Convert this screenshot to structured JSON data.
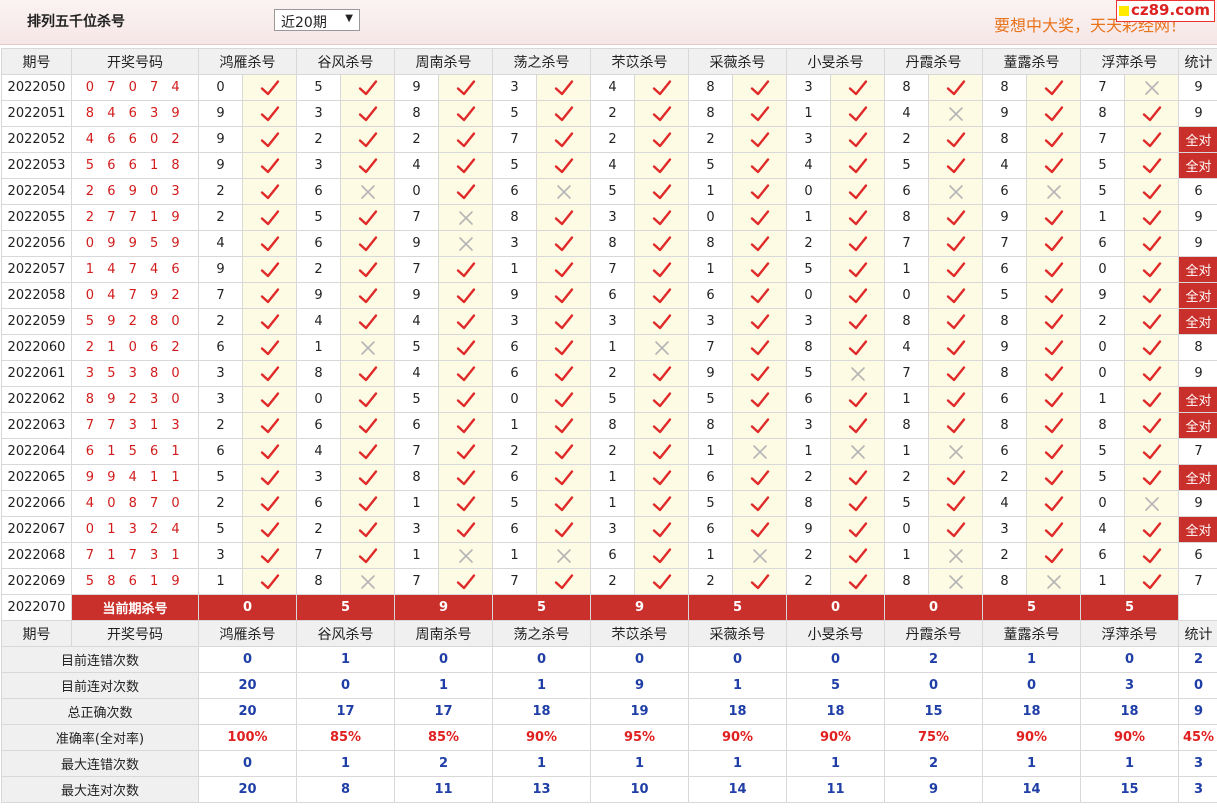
{
  "header": {
    "title": "排列五千位杀号",
    "range_selected": "近20期",
    "ad_text": "要想中大奖，天天彩经网！",
    "logo_text": "cz89.com"
  },
  "columns": {
    "period": "期号",
    "draw": "开奖号码",
    "experts": [
      "鸿雁杀号",
      "谷风杀号",
      "周南杀号",
      "荡之杀号",
      "芣苡杀号",
      "采薇杀号",
      "小旻杀号",
      "丹霞杀号",
      "蕫露杀号",
      "浮萍杀号"
    ],
    "stat": "统计"
  },
  "rows": [
    {
      "period": "2022050",
      "draw": "0 7 0 7 4",
      "kills": [
        "0",
        "5",
        "9",
        "3",
        "4",
        "8",
        "3",
        "8",
        "8",
        "7"
      ],
      "results": [
        "ok",
        "ok",
        "ok",
        "ok",
        "ok",
        "ok",
        "ok",
        "ok",
        "ok",
        "no"
      ],
      "stat": "9"
    },
    {
      "period": "2022051",
      "draw": "8 4 6 3 9",
      "kills": [
        "9",
        "3",
        "8",
        "5",
        "2",
        "8",
        "1",
        "4",
        "9",
        "8"
      ],
      "results": [
        "ok",
        "ok",
        "ok",
        "ok",
        "ok",
        "ok",
        "ok",
        "no",
        "ok",
        "ok"
      ],
      "stat": "9"
    },
    {
      "period": "2022052",
      "draw": "4 6 6 0 2",
      "kills": [
        "9",
        "2",
        "2",
        "7",
        "2",
        "2",
        "3",
        "2",
        "8",
        "7"
      ],
      "results": [
        "ok",
        "ok",
        "ok",
        "ok",
        "ok",
        "ok",
        "ok",
        "ok",
        "ok",
        "ok"
      ],
      "stat": "全对"
    },
    {
      "period": "2022053",
      "draw": "5 6 6 1 8",
      "kills": [
        "9",
        "3",
        "4",
        "5",
        "4",
        "5",
        "4",
        "5",
        "4",
        "5"
      ],
      "results": [
        "ok",
        "ok",
        "ok",
        "ok",
        "ok",
        "ok",
        "ok",
        "ok",
        "ok",
        "ok"
      ],
      "stat": "全对"
    },
    {
      "period": "2022054",
      "draw": "2 6 9 0 3",
      "kills": [
        "2",
        "6",
        "0",
        "6",
        "5",
        "1",
        "0",
        "6",
        "6",
        "5"
      ],
      "results": [
        "ok",
        "no",
        "ok",
        "no",
        "ok",
        "ok",
        "ok",
        "no",
        "no",
        "ok"
      ],
      "stat": "6"
    },
    {
      "period": "2022055",
      "draw": "2 7 7 1 9",
      "kills": [
        "2",
        "5",
        "7",
        "8",
        "3",
        "0",
        "1",
        "8",
        "9",
        "1"
      ],
      "results": [
        "ok",
        "ok",
        "no",
        "ok",
        "ok",
        "ok",
        "ok",
        "ok",
        "ok",
        "ok"
      ],
      "stat": "9"
    },
    {
      "period": "2022056",
      "draw": "0 9 9 5 9",
      "kills": [
        "4",
        "6",
        "9",
        "3",
        "8",
        "8",
        "2",
        "7",
        "7",
        "6"
      ],
      "results": [
        "ok",
        "ok",
        "no",
        "ok",
        "ok",
        "ok",
        "ok",
        "ok",
        "ok",
        "ok"
      ],
      "stat": "9"
    },
    {
      "period": "2022057",
      "draw": "1 4 7 4 6",
      "kills": [
        "9",
        "2",
        "7",
        "1",
        "7",
        "1",
        "5",
        "1",
        "6",
        "0"
      ],
      "results": [
        "ok",
        "ok",
        "ok",
        "ok",
        "ok",
        "ok",
        "ok",
        "ok",
        "ok",
        "ok"
      ],
      "stat": "全对"
    },
    {
      "period": "2022058",
      "draw": "0 4 7 9 2",
      "kills": [
        "7",
        "9",
        "9",
        "9",
        "6",
        "6",
        "0",
        "0",
        "5",
        "9"
      ],
      "results": [
        "ok",
        "ok",
        "ok",
        "ok",
        "ok",
        "ok",
        "ok",
        "ok",
        "ok",
        "ok"
      ],
      "stat": "全对"
    },
    {
      "period": "2022059",
      "draw": "5 9 2 8 0",
      "kills": [
        "2",
        "4",
        "4",
        "3",
        "3",
        "3",
        "3",
        "8",
        "8",
        "2"
      ],
      "results": [
        "ok",
        "ok",
        "ok",
        "ok",
        "ok",
        "ok",
        "ok",
        "ok",
        "ok",
        "ok"
      ],
      "stat": "全对"
    },
    {
      "period": "2022060",
      "draw": "2 1 0 6 2",
      "kills": [
        "6",
        "1",
        "5",
        "6",
        "1",
        "7",
        "8",
        "4",
        "9",
        "0"
      ],
      "results": [
        "ok",
        "no",
        "ok",
        "ok",
        "no",
        "ok",
        "ok",
        "ok",
        "ok",
        "ok"
      ],
      "stat": "8"
    },
    {
      "period": "2022061",
      "draw": "3 5 3 8 0",
      "kills": [
        "3",
        "8",
        "4",
        "6",
        "2",
        "9",
        "5",
        "7",
        "8",
        "0"
      ],
      "results": [
        "ok",
        "ok",
        "ok",
        "ok",
        "ok",
        "ok",
        "no",
        "ok",
        "ok",
        "ok"
      ],
      "stat": "9"
    },
    {
      "period": "2022062",
      "draw": "8 9 2 3 0",
      "kills": [
        "3",
        "0",
        "5",
        "0",
        "5",
        "5",
        "6",
        "1",
        "6",
        "1"
      ],
      "results": [
        "ok",
        "ok",
        "ok",
        "ok",
        "ok",
        "ok",
        "ok",
        "ok",
        "ok",
        "ok"
      ],
      "stat": "全对"
    },
    {
      "period": "2022063",
      "draw": "7 7 3 1 3",
      "kills": [
        "2",
        "6",
        "6",
        "1",
        "8",
        "8",
        "3",
        "8",
        "8",
        "8"
      ],
      "results": [
        "ok",
        "ok",
        "ok",
        "ok",
        "ok",
        "ok",
        "ok",
        "ok",
        "ok",
        "ok"
      ],
      "stat": "全对"
    },
    {
      "period": "2022064",
      "draw": "6 1 5 6 1",
      "kills": [
        "6",
        "4",
        "7",
        "2",
        "2",
        "1",
        "1",
        "1",
        "6",
        "5"
      ],
      "results": [
        "ok",
        "ok",
        "ok",
        "ok",
        "ok",
        "no",
        "no",
        "no",
        "ok",
        "ok"
      ],
      "stat": "7"
    },
    {
      "period": "2022065",
      "draw": "9 9 4 1 1",
      "kills": [
        "5",
        "3",
        "8",
        "6",
        "1",
        "6",
        "2",
        "2",
        "2",
        "5"
      ],
      "results": [
        "ok",
        "ok",
        "ok",
        "ok",
        "ok",
        "ok",
        "ok",
        "ok",
        "ok",
        "ok"
      ],
      "stat": "全对"
    },
    {
      "period": "2022066",
      "draw": "4 0 8 7 0",
      "kills": [
        "2",
        "6",
        "1",
        "5",
        "1",
        "5",
        "8",
        "5",
        "4",
        "0"
      ],
      "results": [
        "ok",
        "ok",
        "ok",
        "ok",
        "ok",
        "ok",
        "ok",
        "ok",
        "ok",
        "no"
      ],
      "stat": "9"
    },
    {
      "period": "2022067",
      "draw": "0 1 3 2 4",
      "kills": [
        "5",
        "2",
        "3",
        "6",
        "3",
        "6",
        "9",
        "0",
        "3",
        "4"
      ],
      "results": [
        "ok",
        "ok",
        "ok",
        "ok",
        "ok",
        "ok",
        "ok",
        "ok",
        "ok",
        "ok"
      ],
      "stat": "全对"
    },
    {
      "period": "2022068",
      "draw": "7 1 7 3 1",
      "kills": [
        "3",
        "7",
        "1",
        "1",
        "6",
        "1",
        "2",
        "1",
        "2",
        "6"
      ],
      "results": [
        "ok",
        "ok",
        "no",
        "no",
        "ok",
        "no",
        "ok",
        "no",
        "ok",
        "ok"
      ],
      "stat": "6"
    },
    {
      "period": "2022069",
      "draw": "5 8 6 1 9",
      "kills": [
        "1",
        "8",
        "7",
        "7",
        "2",
        "2",
        "2",
        "8",
        "8",
        "1"
      ],
      "results": [
        "ok",
        "no",
        "ok",
        "ok",
        "ok",
        "ok",
        "ok",
        "no",
        "no",
        "ok"
      ],
      "stat": "7"
    }
  ],
  "current": {
    "period": "2022070",
    "label": "当前期杀号",
    "kills": [
      "0",
      "5",
      "9",
      "5",
      "9",
      "5",
      "0",
      "0",
      "5",
      "5"
    ]
  },
  "stats": [
    {
      "label": "目前连错次数",
      "values": [
        "0",
        "1",
        "0",
        "0",
        "0",
        "0",
        "0",
        "2",
        "1",
        "0"
      ],
      "stat": "2",
      "pct": false
    },
    {
      "label": "目前连对次数",
      "values": [
        "20",
        "0",
        "1",
        "1",
        "9",
        "1",
        "5",
        "0",
        "0",
        "3"
      ],
      "stat": "0",
      "pct": false
    },
    {
      "label": "总正确次数",
      "values": [
        "20",
        "17",
        "17",
        "18",
        "19",
        "18",
        "18",
        "15",
        "18",
        "18"
      ],
      "stat": "9",
      "pct": false
    },
    {
      "label": "准确率(全对率)",
      "values": [
        "100%",
        "85%",
        "85%",
        "90%",
        "95%",
        "90%",
        "90%",
        "75%",
        "90%",
        "90%"
      ],
      "stat": "45%",
      "pct": true
    },
    {
      "label": "最大连错次数",
      "values": [
        "0",
        "1",
        "2",
        "1",
        "1",
        "1",
        "1",
        "2",
        "1",
        "1"
      ],
      "stat": "3",
      "pct": false
    },
    {
      "label": "最大连对次数",
      "values": [
        "20",
        "8",
        "11",
        "13",
        "10",
        "14",
        "11",
        "9",
        "14",
        "15"
      ],
      "stat": "3",
      "pct": false
    }
  ],
  "colors": {
    "accent": "#c9302c",
    "check": "#e02a2a",
    "cross": "#b5b5b5",
    "stat_blue": "#1f3ea6",
    "ad_orange": "#e8741c"
  }
}
